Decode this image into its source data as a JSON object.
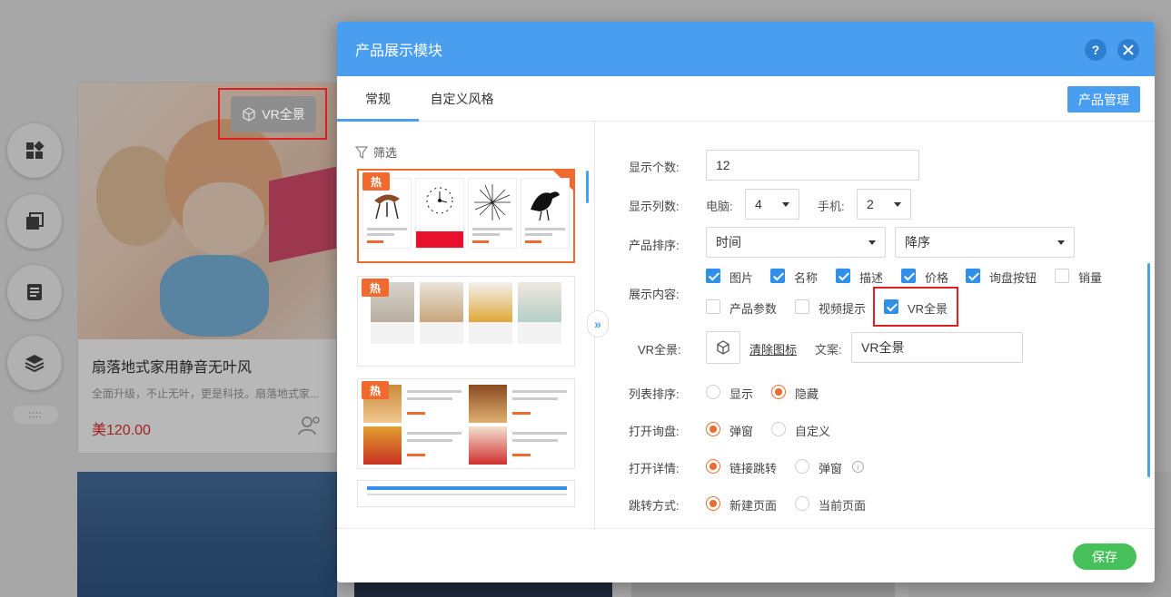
{
  "background": {
    "card": {
      "vr_badge": "VR全景",
      "title": "扇落地式家用静音无叶风",
      "desc": "全面升级，不止无叶，更是科技。扇落地式家...",
      "price": "美120.00"
    },
    "side_more": "::::"
  },
  "modal": {
    "title": "产品展示模块",
    "help": "?",
    "tabs": [
      "常规",
      "自定义风格"
    ],
    "manage_button": "产品管理",
    "filter_label": "筛选",
    "hot_tag": "热",
    "expand": "»",
    "form": {
      "count": {
        "label": "显示个数:",
        "value": "12"
      },
      "columns": {
        "label": "显示列数:",
        "pc_label": "电脑:",
        "pc_value": "4",
        "mobile_label": "手机:",
        "mobile_value": "2"
      },
      "sort": {
        "label": "产品排序:",
        "field": "时间",
        "order": "降序"
      },
      "content": {
        "label": "展示内容:",
        "items": [
          {
            "label": "图片",
            "checked": true
          },
          {
            "label": "名称",
            "checked": true
          },
          {
            "label": "描述",
            "checked": true
          },
          {
            "label": "价格",
            "checked": true
          },
          {
            "label": "询盘按钮",
            "checked": true
          },
          {
            "label": "销量",
            "checked": false
          },
          {
            "label": "产品参数",
            "checked": false
          },
          {
            "label": "视频提示",
            "checked": false
          },
          {
            "label": "VR全景",
            "checked": true
          }
        ]
      },
      "vr": {
        "label": "VR全景:",
        "clear_link": "清除图标",
        "text_label": "文案:",
        "text_value": "VR全景"
      },
      "list_sort": {
        "label": "列表排序:",
        "options": [
          "显示",
          "隐藏"
        ],
        "selected": "隐藏"
      },
      "open_inquiry": {
        "label": "打开询盘:",
        "options": [
          "弹窗",
          "自定义"
        ],
        "selected": "弹窗"
      },
      "open_detail": {
        "label": "打开详情:",
        "options": [
          "链接跳转",
          "弹窗"
        ],
        "selected": "链接跳转",
        "info": "i"
      },
      "jump_mode": {
        "label": "跳转方式:",
        "options": [
          "新建页面",
          "当前页面"
        ],
        "selected": "新建页面"
      }
    },
    "save_button": "保存"
  },
  "colors": {
    "primary": "#4a9ef0",
    "accent": "#f06a2f",
    "save": "#45c05a",
    "highlight": "#e02020"
  }
}
